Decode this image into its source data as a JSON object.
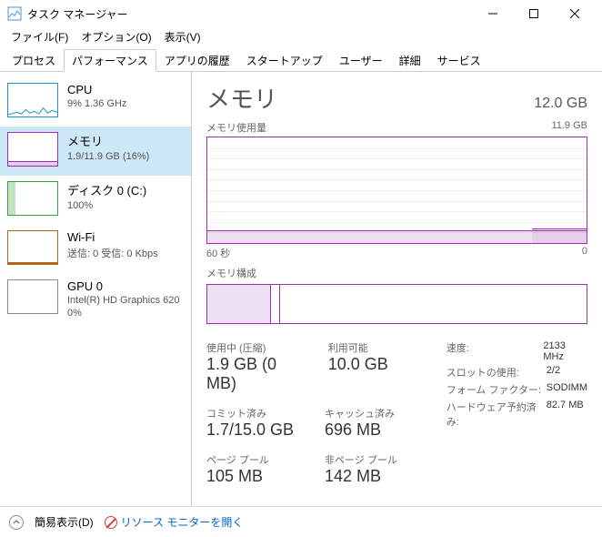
{
  "window": {
    "title": "タスク マネージャー"
  },
  "menu": {
    "file": "ファイル(F)",
    "options": "オプション(O)",
    "view": "表示(V)"
  },
  "tabs": {
    "processes": "プロセス",
    "performance": "パフォーマンス",
    "app_history": "アプリの履歴",
    "startup": "スタートアップ",
    "users": "ユーザー",
    "details": "詳細",
    "services": "サービス"
  },
  "sidebar": {
    "cpu": {
      "title": "CPU",
      "sub": "9%  1.36 GHz"
    },
    "memory": {
      "title": "メモリ",
      "sub": "1.9/11.9 GB (16%)"
    },
    "disk": {
      "title": "ディスク 0 (C:)",
      "sub": "100%"
    },
    "wifi": {
      "title": "Wi-Fi",
      "sub": "送信: 0 受信: 0 Kbps"
    },
    "gpu": {
      "title": "GPU 0",
      "sub1": "Intel(R) HD Graphics 620",
      "sub2": "0%"
    }
  },
  "main": {
    "title": "メモリ",
    "total": "12.0 GB",
    "usage_label": "メモリ使用量",
    "usage_max": "11.9 GB",
    "x_left": "60 秒",
    "x_right": "0",
    "comp_label": "メモリ構成",
    "stats": {
      "in_use_label": "使用中 (圧縮)",
      "in_use": "1.9 GB (0 MB)",
      "avail_label": "利用可能",
      "avail": "10.0 GB",
      "commit_label": "コミット済み",
      "commit": "1.7/15.0 GB",
      "cache_label": "キャッシュ済み",
      "cache": "696 MB",
      "paged_label": "ページ プール",
      "paged": "105 MB",
      "nonpaged_label": "非ページ プール",
      "nonpaged": "142 MB"
    },
    "right": {
      "speed_label": "速度:",
      "speed": "2133 MHz",
      "slots_label": "スロットの使用:",
      "slots": "2/2",
      "form_label": "フォーム ファクター:",
      "form": "SODIMM",
      "hw_label": "ハードウェア予約済み:",
      "hw": "82.7 MB"
    }
  },
  "footer": {
    "fewer": "簡易表示(D)",
    "resmon": "リソース モニターを開く"
  },
  "chart_data": {
    "type": "area",
    "title": "メモリ使用量",
    "x": [
      60,
      0
    ],
    "xlabel": "秒",
    "ylim": [
      0,
      11.9
    ],
    "ylabel": "GB",
    "series": [
      {
        "name": "使用中",
        "values_approx": 1.9,
        "note": "flat line near bottom ~16% with slight step up near right edge"
      }
    ],
    "composition": {
      "total_gb": 11.9,
      "in_use_gb": 1.9,
      "modified_gb_approx": 0.2,
      "standby_cached_gb_approx": 0.7,
      "free_gb_approx": 9.1
    }
  }
}
